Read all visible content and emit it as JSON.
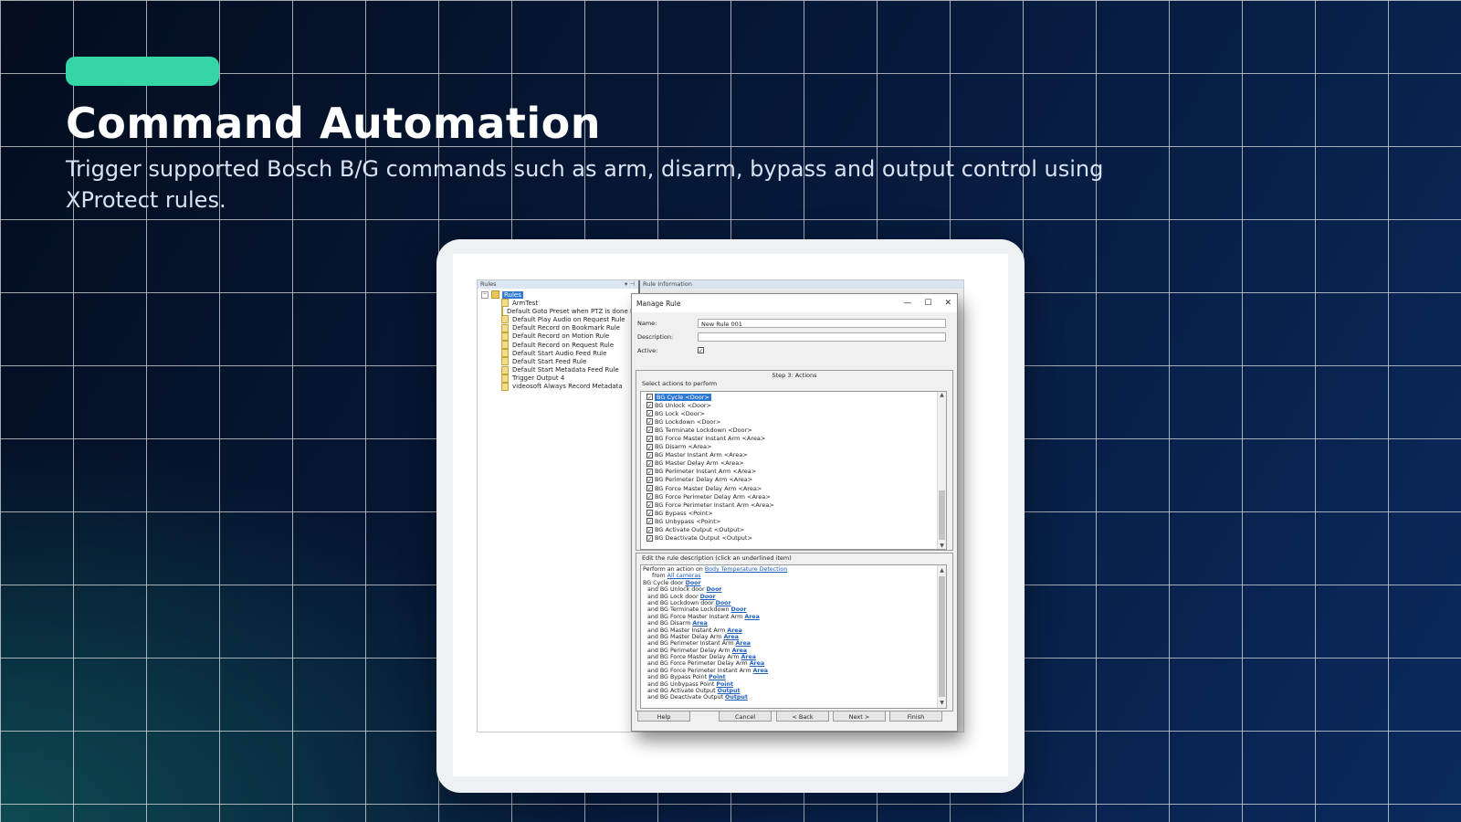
{
  "slide": {
    "title": "Command Automation",
    "subtitle": "Trigger supported Bosch B/G commands such as arm, disarm, bypass and output control using XProtect rules.",
    "colors": {
      "accent_pill": "#35d5a6",
      "background_dark": "#040d1f",
      "background_blue": "#0a2a5c",
      "background_teal": "#0e4a52"
    }
  },
  "rules_panel": {
    "header": "Rules",
    "root_label": "Rules",
    "items": [
      "ArmTest",
      "Default Goto Preset when PTZ is done Rule",
      "Default Play Audio on Request Rule",
      "Default Record on Bookmark Rule",
      "Default Record on Motion Rule",
      "Default Record on Request Rule",
      "Default Start Audio Feed Rule",
      "Default Start Feed Rule",
      "Default Start Metadata Feed Rule",
      "Trigger Output 4",
      "videosoft Always Record Metadata"
    ]
  },
  "info_panel": {
    "header": "Rule Information"
  },
  "dialog": {
    "title": "Manage Rule",
    "name_label": "Name:",
    "name_value": "New Rule 001",
    "description_label": "Description:",
    "description_value": "",
    "active_label": "Active:",
    "step_title": "Step 3: Actions",
    "select_label": "Select actions to perform",
    "actions": [
      "BG Cycle <Door>",
      "BG Unlock <Door>",
      "BG Lock <Door>",
      "BG Lockdown <Door>",
      "BG Terminate Lockdown <Door>",
      "BG Force Master Instant Arm <Area>",
      "BG Disarm <Area>",
      "BG Master Instant Arm <Area>",
      "BG Master Delay Arm <Area>",
      "BG Perimeter Instant Arm <Area>",
      "BG Perimeter Delay Arm <Area>",
      "BG Force Master Delay Arm <Area>",
      "BG Force Perimeter Delay Arm <Area>",
      "BG Force Perimeter Instant Arm <Area>",
      "BG Bypass <Point>",
      "BG Unbypass <Point>",
      "BG Activate Output <Output>",
      "BG Deactivate Output <Output>"
    ],
    "edit_label": "Edit the rule description (click an underlined item)",
    "description_lines": [
      {
        "indent": 0,
        "text": "Perform an action on ",
        "link": "Body Temperature Detection"
      },
      {
        "indent": 2,
        "text": "from ",
        "link": "All cameras"
      },
      {
        "indent": 0,
        "text": "BG Cycle door ",
        "link": "Door"
      },
      {
        "indent": 1,
        "text": "and BG Unlock door ",
        "link": "Door"
      },
      {
        "indent": 1,
        "text": "and BG Lock door ",
        "link": "Door"
      },
      {
        "indent": 1,
        "text": "and BG Lockdown door ",
        "link": "Door"
      },
      {
        "indent": 1,
        "text": "and BG Terminate Lockdown ",
        "link": "Door"
      },
      {
        "indent": 1,
        "text": "and BG Force Master Instant Arm ",
        "link": "Area"
      },
      {
        "indent": 1,
        "text": "and BG Disarm ",
        "link": "Area"
      },
      {
        "indent": 1,
        "text": "and BG Master Instant Arm ",
        "link": "Area"
      },
      {
        "indent": 1,
        "text": "and BG Master Delay Arm ",
        "link": "Area"
      },
      {
        "indent": 1,
        "text": "and BG Perimeter Instant Arm ",
        "link": "Area"
      },
      {
        "indent": 1,
        "text": "and BG Perimeter Delay Arm ",
        "link": "Area"
      },
      {
        "indent": 1,
        "text": "and BG Force Master Delay Arm ",
        "link": "Area"
      },
      {
        "indent": 1,
        "text": "and BG Force Perimeter Delay Arm ",
        "link": "Area"
      },
      {
        "indent": 1,
        "text": "and BG Force Perimeter Instant Arm ",
        "link": "Area"
      },
      {
        "indent": 1,
        "text": "and BG Bypass Point ",
        "link": "Point"
      },
      {
        "indent": 1,
        "text": "and BG Unbypass Point ",
        "link": "Point"
      },
      {
        "indent": 1,
        "text": "and BG Activate Output ",
        "link": "Output"
      },
      {
        "indent": 1,
        "text": "and BG Deactivate Output ",
        "link": "Output"
      }
    ],
    "buttons": {
      "help": "Help",
      "cancel": "Cancel",
      "back": "< Back",
      "next": "Next >",
      "finish": "Finish"
    }
  }
}
